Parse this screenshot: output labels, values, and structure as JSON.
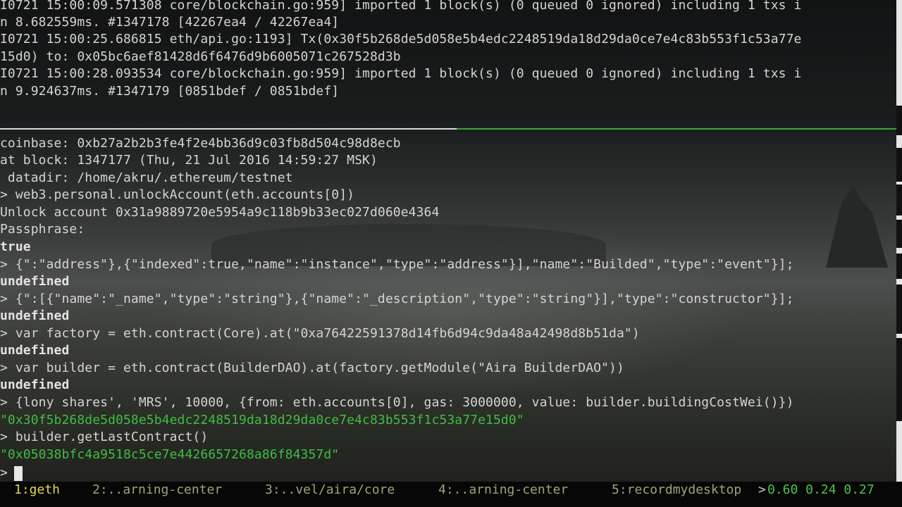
{
  "terminal": {
    "lines": [
      "I0721 15:00:09.571308 core/blockchain.go:959] imported 1 block(s) (0 queued 0 ignored) including 1 txs i",
      "n 8.682559ms. #1347178 [42267ea4 / 42267ea4]",
      "I0721 15:00:25.686815 eth/api.go:1193] Tx(0x30f5b268de5d058e5b4edc2248519da18d29da0ce7e4c83b553f1c53a77e",
      "15d0) to: 0x05bc6aef81428d6f6476d9b6005071c267528d3b",
      "I0721 15:00:28.093534 core/blockchain.go:959] imported 1 block(s) (0 queued 0 ignored) including 1 txs i",
      "n 9.924637ms. #1347179 [0851bdef / 0851bdef]",
      "coinbase: 0xb27a2b2b3fe4f2e4bb36d9c03fb8d504c98d8ecb",
      "at block: 1347177 (Thu, 21 Jul 2016 14:59:27 MSK)",
      " datadir: /home/akru/.ethereum/testnet",
      "> web3.personal.unlockAccount(eth.accounts[0])",
      "Unlock account 0x31a9889720e5954a9c118b9b33ec027d060e4364",
      "Passphrase:",
      "true",
      "> {\":\"address\"},{\"indexed\":true,\"name\":\"instance\",\"type\":\"address\"}],\"name\":\"Builded\",\"type\":\"event\"}];",
      "undefined",
      "> {\":[{\"name\":\"_name\",\"type\":\"string\"},{\"name\":\"_description\",\"type\":\"string\"}],\"type\":\"constructor\"}];",
      "undefined",
      "> var factory = eth.contract(Core).at(\"0xa76422591378d14fb6d94c9da48a42498d8b51da\")",
      "undefined",
      "> var builder = eth.contract(BuilderDAO).at(factory.getModule(\"Aira BuilderDAO\"))",
      "undefined",
      "> {lony shares', 'MRS', 10000, {from: eth.accounts[0], gas: 3000000, value: builder.buildingCostWei()})",
      "\"0x30f5b268de5d058e5b4edc2248519da18d29da0ce7e4c83b553f1c53a77e15d0\"",
      "> builder.getLastContract()",
      "\"0x05038bfc4a9518c5ce7e4426657268a86f84357d\"",
      ">"
    ]
  },
  "statusbar": {
    "windows": [
      "1:geth",
      "2:..arning-center",
      "3:..vel/aira/core",
      "4:..arning-center",
      "5:recordmydesktop"
    ],
    "separator": ">",
    "load": "0.60 0.24 0.27"
  },
  "colors": {
    "output_green": "#3fbf3f",
    "active_window": "#e2d84a",
    "inactive_window": "#a2a27a",
    "load_green": "#4ec24e"
  }
}
